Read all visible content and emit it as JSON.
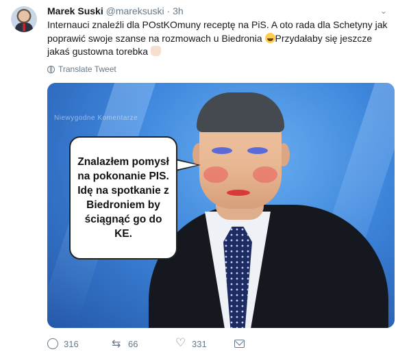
{
  "tweet": {
    "author_name": "Marek Suski",
    "handle": "@mareksuski",
    "separator": "·",
    "time": "3h",
    "text_main": "Internauci znaleźli dla POstKOmuny receptę na PiS. A oto rada dla Schetyny jak poprawić swoje szanse na rozmowach u Biedronia ",
    "text_after_emoji": "Przydałaby się jeszcze jakaś gustowna torebka ",
    "translate_label": "Translate Tweet",
    "icons": {
      "laugh_emoji": "face-with-tears-of-joy-icon",
      "hand_emoji": "ok-hand-icon",
      "globe": "globe-icon",
      "menu": "chevron-down-icon"
    }
  },
  "media": {
    "watermark": "Niewygodne Komentarze",
    "speech_bubble": "Znalazłem pomysł na pokonanie PIS. Idę na spotkanie z Biedroniem by ściągnąć go do KE."
  },
  "actions": {
    "reply_count": "316",
    "retweet_count": "66",
    "like_count": "331",
    "icons": [
      "reply-icon",
      "retweet-icon",
      "like-icon",
      "direct-message-icon"
    ]
  },
  "colors": {
    "text": "#14171a",
    "secondary": "#657786",
    "background": "#ffffff"
  }
}
